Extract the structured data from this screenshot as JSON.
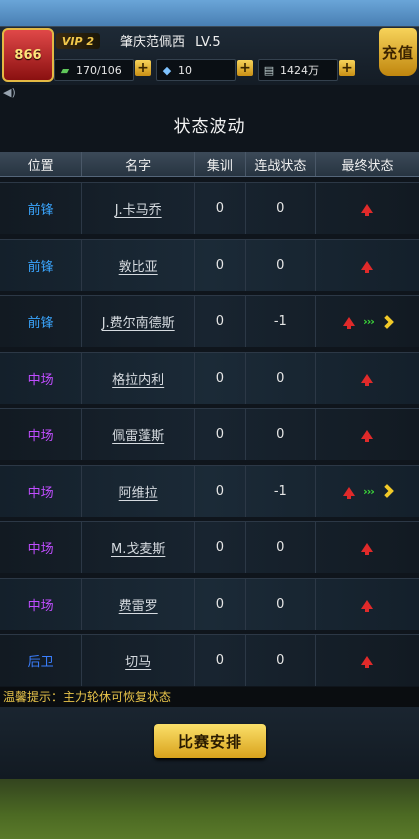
{
  "header": {
    "avatar_number": "866",
    "vip_label": "VIP 2",
    "username": "肇庆范佩西",
    "level": "LV.5",
    "stamina": "170/106",
    "diamonds": "10",
    "coins": "1424万",
    "recharge_label": "充值"
  },
  "title": "状态波动",
  "table": {
    "columns": [
      "位置",
      "名字",
      "集训",
      "连战状态",
      "最终状态"
    ],
    "rows": [
      {
        "position": "前锋",
        "name": "J.卡马乔",
        "training": "0",
        "streak": "0",
        "final": "up"
      },
      {
        "position": "前锋",
        "name": "敦比亚",
        "training": "0",
        "streak": "0",
        "final": "up"
      },
      {
        "position": "前锋",
        "name": "J.费尔南德斯",
        "training": "0",
        "streak": "-1",
        "final": "up-to-down"
      },
      {
        "position": "中场",
        "name": "格拉内利",
        "training": "0",
        "streak": "0",
        "final": "up"
      },
      {
        "position": "中场",
        "name": "佩雷蓬斯",
        "training": "0",
        "streak": "0",
        "final": "up"
      },
      {
        "position": "中场",
        "name": "阿维拉",
        "training": "0",
        "streak": "-1",
        "final": "up-to-down"
      },
      {
        "position": "中场",
        "name": "M.戈麦斯",
        "training": "0",
        "streak": "0",
        "final": "up"
      },
      {
        "position": "中场",
        "name": "费雷罗",
        "training": "0",
        "streak": "0",
        "final": "up"
      },
      {
        "position": "后卫",
        "name": "切马",
        "training": "0",
        "streak": "0",
        "final": "up"
      }
    ]
  },
  "tip": "温馨提示：主力轮休可恢复状态",
  "match_button": "比赛安排",
  "colors": {
    "forward": "#3aa6ff",
    "midfield": "#c04dff",
    "defender": "#3a7fff",
    "accent": "#f2c84b"
  }
}
